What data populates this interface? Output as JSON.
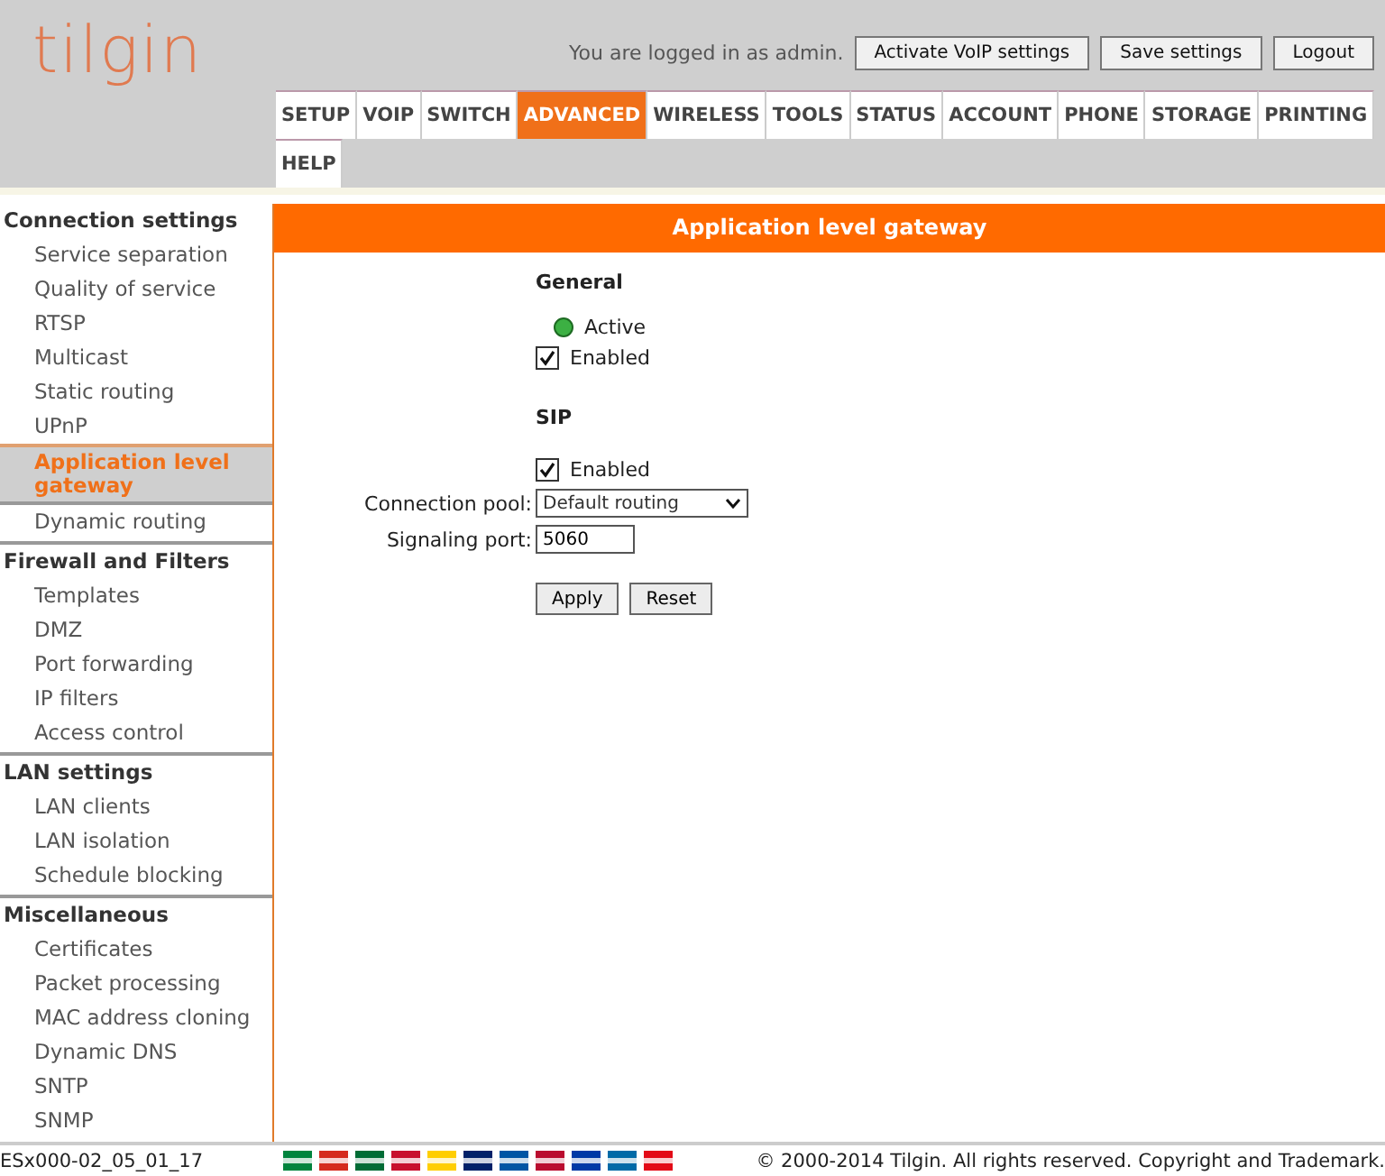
{
  "logo": "tilgin",
  "user_bar": {
    "text": "You are logged in as admin.",
    "buttons": [
      "Activate VoIP settings",
      "Save settings",
      "Logout"
    ]
  },
  "nav_tabs": [
    {
      "label": "SETUP",
      "selected": false
    },
    {
      "label": "VOIP",
      "selected": false
    },
    {
      "label": "SWITCH",
      "selected": false
    },
    {
      "label": "ADVANCED",
      "selected": true
    },
    {
      "label": "WIRELESS",
      "selected": false
    },
    {
      "label": "TOOLS",
      "selected": false
    },
    {
      "label": "STATUS",
      "selected": false
    },
    {
      "label": "ACCOUNT",
      "selected": false
    },
    {
      "label": "PHONE",
      "selected": false
    },
    {
      "label": "STORAGE",
      "selected": false
    },
    {
      "label": "PRINTING",
      "selected": false
    },
    {
      "label": "HELP",
      "selected": false
    }
  ],
  "sidebar": [
    {
      "title": "Connection settings",
      "items": [
        {
          "label": "Service separation",
          "selected": false
        },
        {
          "label": "Quality of service",
          "selected": false
        },
        {
          "label": "RTSP",
          "selected": false
        },
        {
          "label": "Multicast",
          "selected": false
        },
        {
          "label": "Static routing",
          "selected": false
        },
        {
          "label": "UPnP",
          "selected": false
        },
        {
          "label": "Application level gateway",
          "selected": true
        },
        {
          "label": "Dynamic routing",
          "selected": false
        }
      ]
    },
    {
      "title": "Firewall and Filters",
      "items": [
        {
          "label": "Templates",
          "selected": false
        },
        {
          "label": "DMZ",
          "selected": false
        },
        {
          "label": "Port forwarding",
          "selected": false
        },
        {
          "label": "IP filters",
          "selected": false
        },
        {
          "label": "Access control",
          "selected": false
        }
      ]
    },
    {
      "title": "LAN settings",
      "items": [
        {
          "label": "LAN clients",
          "selected": false
        },
        {
          "label": "LAN isolation",
          "selected": false
        },
        {
          "label": "Schedule blocking",
          "selected": false
        }
      ]
    },
    {
      "title": "Miscellaneous",
      "items": [
        {
          "label": "Certificates",
          "selected": false
        },
        {
          "label": "Packet processing",
          "selected": false
        },
        {
          "label": "MAC address cloning",
          "selected": false
        },
        {
          "label": "Dynamic DNS",
          "selected": false
        },
        {
          "label": "SNTP",
          "selected": false
        },
        {
          "label": "SNMP",
          "selected": false
        }
      ]
    }
  ],
  "content": {
    "title": "Application level gateway",
    "general": {
      "heading": "General",
      "status": {
        "label": "Active",
        "active": true
      },
      "enabled": {
        "label": "Enabled",
        "checked": true
      }
    },
    "sip": {
      "heading": "SIP",
      "enabled": {
        "label": "Enabled",
        "checked": true
      },
      "connection_pool": {
        "label": "Connection pool:",
        "value": "Default routing"
      },
      "signaling_port": {
        "label": "Signaling port:",
        "value": "5060"
      }
    },
    "buttons": [
      "Apply",
      "Reset"
    ]
  },
  "footer": {
    "version": "ESx000-02_05_01_17",
    "flags": [
      {
        "color": "#00843d"
      },
      {
        "color": "#d52b1e"
      },
      {
        "color": "#006c35"
      },
      {
        "color": "#c8102e"
      },
      {
        "color": "#ffce00"
      },
      {
        "color": "#012169"
      },
      {
        "color": "#0055a4"
      },
      {
        "color": "#ba0c2f"
      },
      {
        "color": "#0039a6"
      },
      {
        "color": "#006aa7"
      },
      {
        "color": "#e30a17"
      }
    ],
    "copyright": "© 2000-2014 Tilgin. All rights reserved. Copyright and Trademark."
  }
}
